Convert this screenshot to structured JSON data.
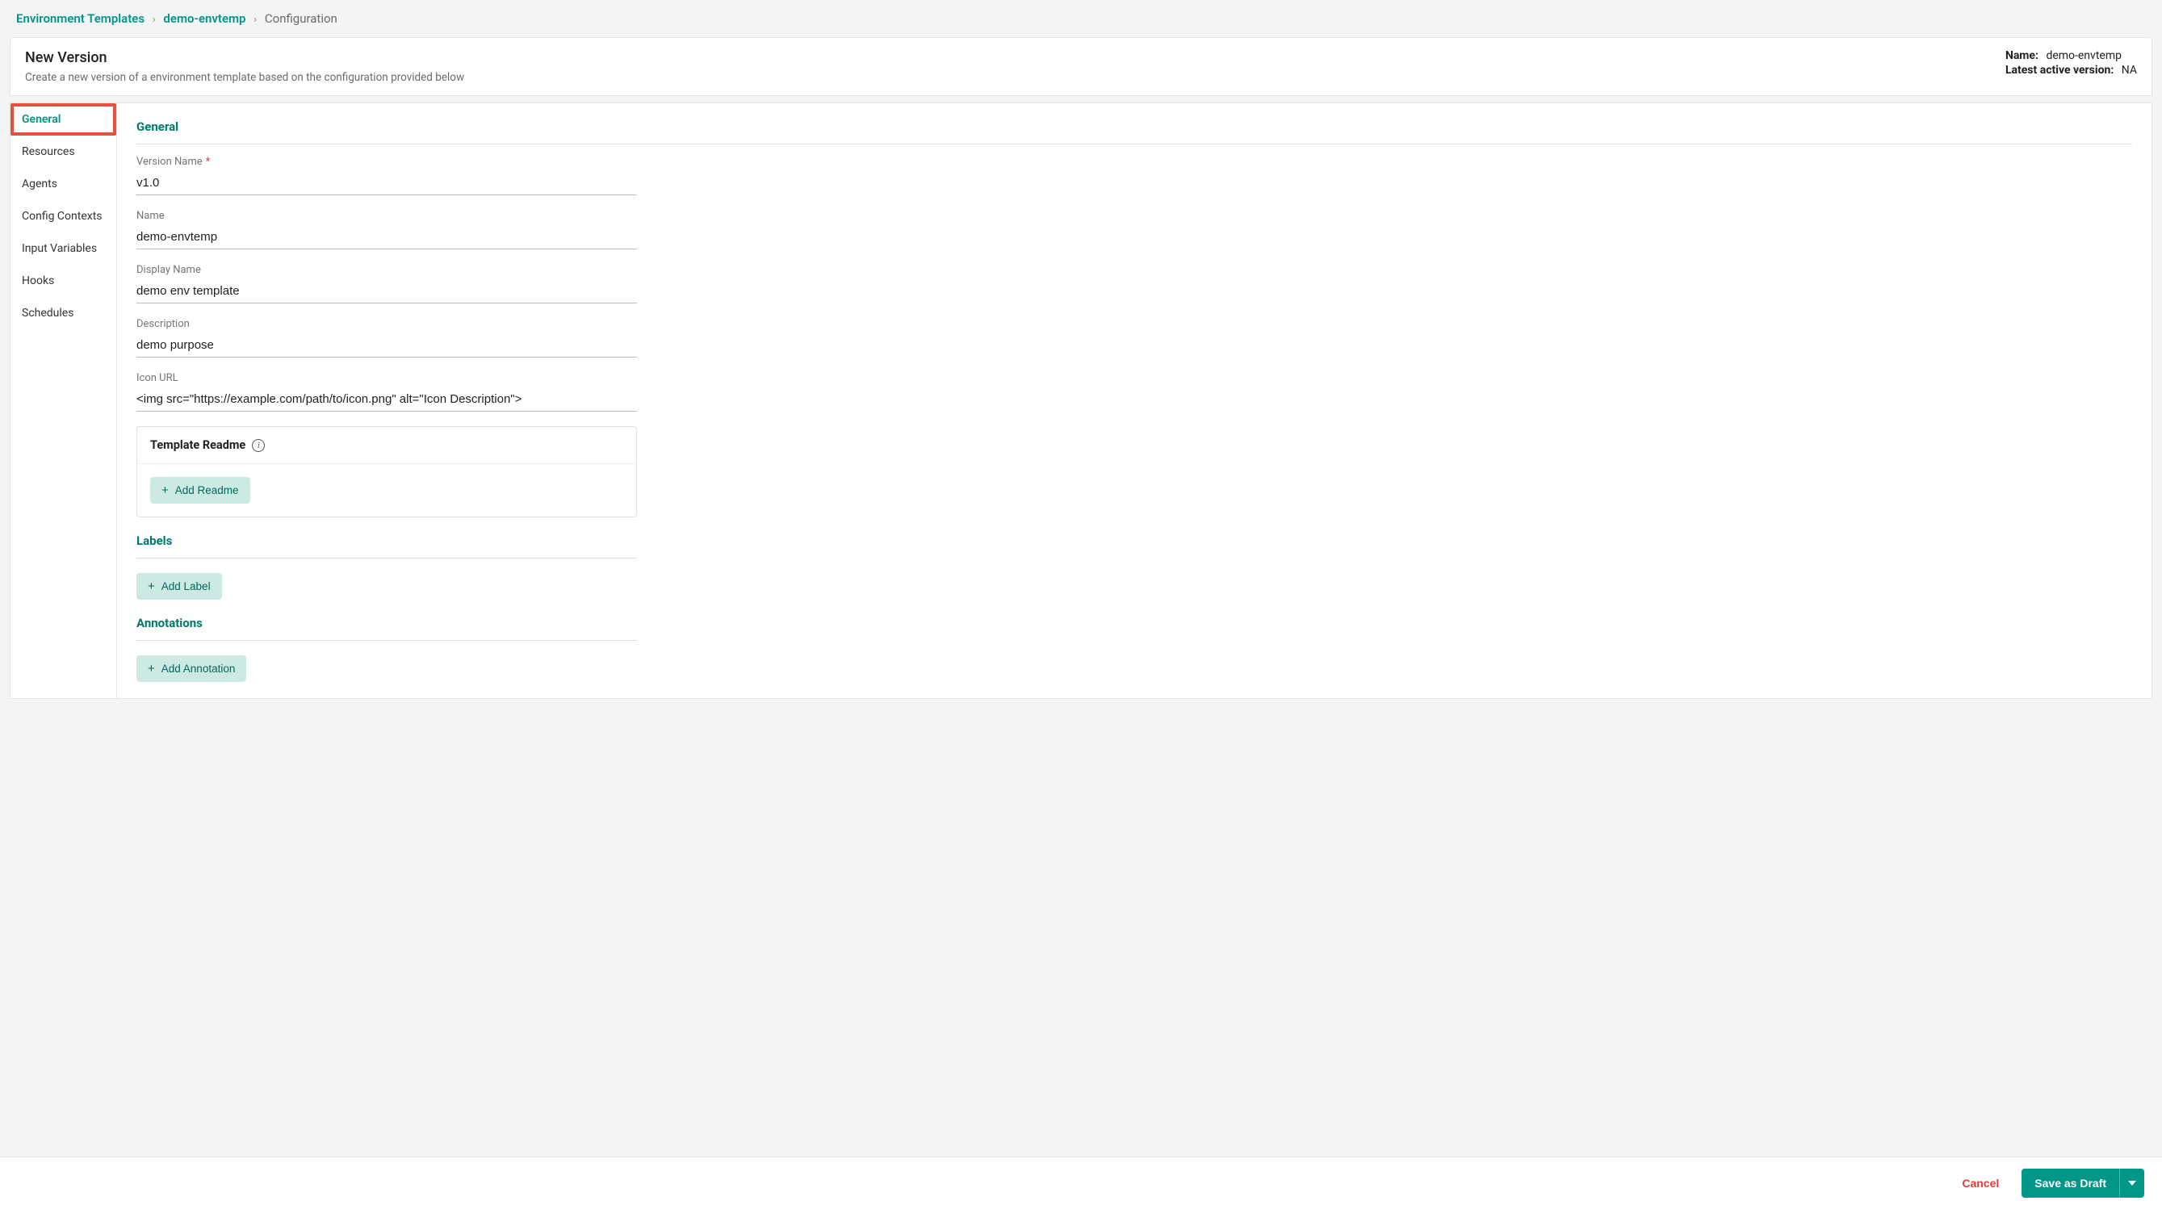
{
  "breadcrumb": {
    "root": "Environment Templates",
    "mid": "demo-envtemp",
    "current": "Configuration"
  },
  "header": {
    "title": "New Version",
    "subtitle": "Create a new version of a environment template based on the configuration provided below",
    "name_label": "Name:",
    "name_value": "demo-envtemp",
    "latest_label": "Latest active version:",
    "latest_value": "NA"
  },
  "sidebar": {
    "items": [
      "General",
      "Resources",
      "Agents",
      "Config Contexts",
      "Input Variables",
      "Hooks",
      "Schedules"
    ]
  },
  "section": {
    "general": "General",
    "labels": "Labels",
    "annotations": "Annotations"
  },
  "fields": {
    "version_name": {
      "label": "Version Name",
      "value": "v1.0"
    },
    "name": {
      "label": "Name",
      "value": "demo-envtemp"
    },
    "display_name": {
      "label": "Display Name",
      "value": "demo env template"
    },
    "description": {
      "label": "Description",
      "value": "demo purpose"
    },
    "icon_url": {
      "label": "Icon URL",
      "value": "<img src=\"https://example.com/path/to/icon.png\" alt=\"Icon Description\">"
    }
  },
  "readme": {
    "title": "Template Readme",
    "add": "Add Readme"
  },
  "labels_btn": "Add Label",
  "annotations_btn": "Add Annotation",
  "footer": {
    "cancel": "Cancel",
    "save": "Save as Draft"
  }
}
